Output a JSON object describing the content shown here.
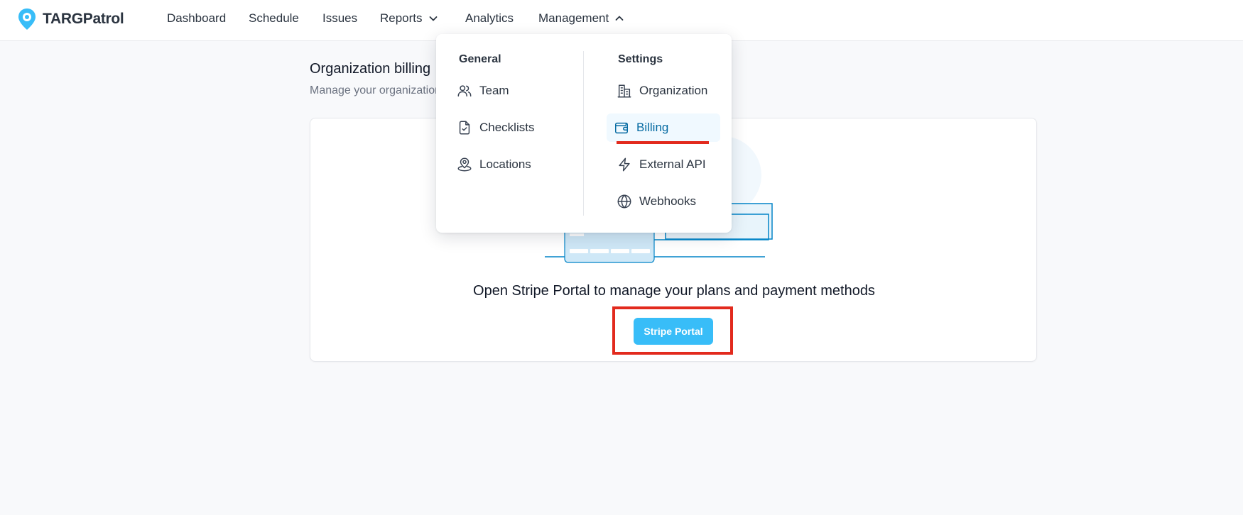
{
  "app": {
    "name": "TARGPatrol"
  },
  "nav": {
    "items": [
      {
        "label": "Dashboard"
      },
      {
        "label": "Schedule"
      },
      {
        "label": "Issues"
      },
      {
        "label": "Reports",
        "icon": "chevron-down-icon"
      },
      {
        "label": "Analytics"
      },
      {
        "label": "Management",
        "icon": "chevron-up-icon"
      }
    ]
  },
  "page": {
    "title": "Organization billing",
    "subtitle": "Manage your organization"
  },
  "card": {
    "heading": "Open Stripe Portal to manage your plans and payment methods",
    "button_label": "Stripe Portal"
  },
  "menu": {
    "general": {
      "title": "General",
      "items": [
        {
          "label": "Team",
          "icon": "users-icon"
        },
        {
          "label": "Checklists",
          "icon": "file-check-icon"
        },
        {
          "label": "Locations",
          "icon": "map-pin-icon"
        }
      ]
    },
    "settings": {
      "title": "Settings",
      "items": [
        {
          "label": "Organization",
          "icon": "building-icon"
        },
        {
          "label": "Billing",
          "icon": "wallet-icon",
          "active": true
        },
        {
          "label": "External API",
          "icon": "bolt-icon"
        },
        {
          "label": "Webhooks",
          "icon": "globe-icon"
        }
      ]
    }
  },
  "colors": {
    "accent": "#38bdf8",
    "active_text": "#0369a1",
    "annotation": "#e22a1d"
  }
}
